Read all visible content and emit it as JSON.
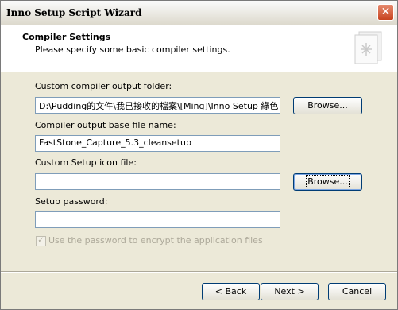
{
  "window": {
    "title": "Inno Setup Script Wizard"
  },
  "header": {
    "title": "Compiler Settings",
    "subtitle": "Please specify some basic compiler settings.",
    "icon": "wizard-document-icon"
  },
  "form": {
    "output_folder": {
      "label": "Custom compiler output folder:",
      "value": "D:\\Pudding的文件\\我已接收的檔案\\[Ming]\\Inno Setup 綠色",
      "browse_label": "Browse..."
    },
    "base_filename": {
      "label": "Compiler output base file name:",
      "value": "FastStone_Capture_5.3_cleansetup"
    },
    "icon_file": {
      "label": "Custom Setup icon file:",
      "value": "",
      "browse_label": "Browse..."
    },
    "password": {
      "label": "Setup password:",
      "value": ""
    },
    "encrypt": {
      "label": "Use the password to encrypt the application files",
      "checked": true,
      "enabled": false
    }
  },
  "footer": {
    "back_label": "< Back",
    "next_label": "Next >",
    "cancel_label": "Cancel"
  }
}
